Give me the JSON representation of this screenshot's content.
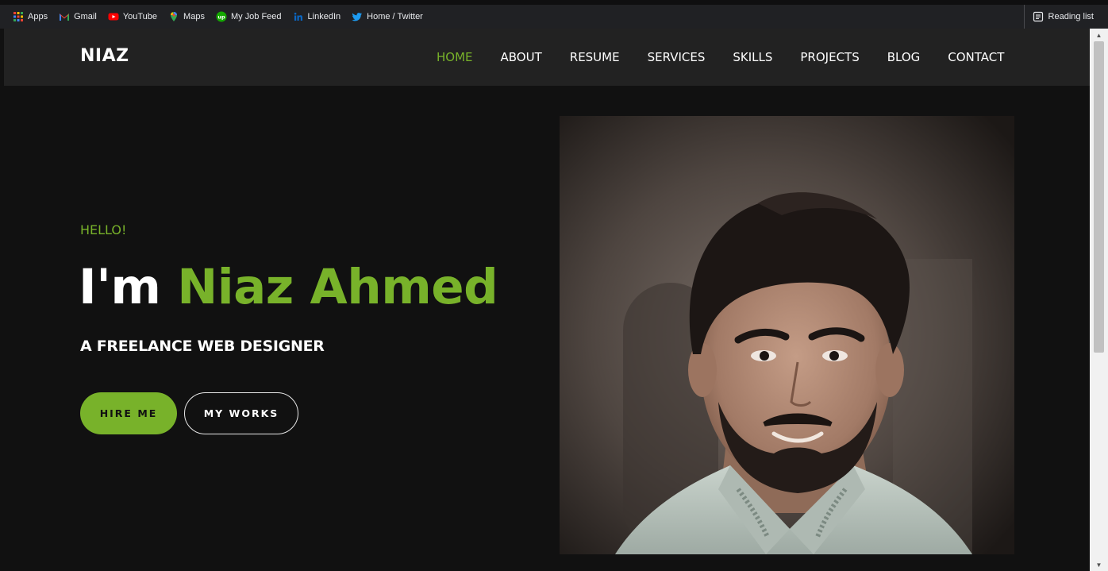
{
  "browser": {
    "bookmarks": [
      {
        "label": "Apps",
        "icon": "apps-grid-icon"
      },
      {
        "label": "Gmail",
        "icon": "gmail-icon"
      },
      {
        "label": "YouTube",
        "icon": "youtube-icon"
      },
      {
        "label": "Maps",
        "icon": "maps-icon"
      },
      {
        "label": "My Job Feed",
        "icon": "upwork-icon"
      },
      {
        "label": "LinkedIn",
        "icon": "linkedin-icon"
      },
      {
        "label": "Home / Twitter",
        "icon": "twitter-icon"
      }
    ],
    "reading_list": "Reading list"
  },
  "site": {
    "logo": "NIAZ",
    "nav": [
      {
        "label": "HOME",
        "active": true
      },
      {
        "label": "ABOUT",
        "active": false
      },
      {
        "label": "RESUME",
        "active": false
      },
      {
        "label": "SERVICES",
        "active": false
      },
      {
        "label": "SKILLS",
        "active": false
      },
      {
        "label": "PROJECTS",
        "active": false
      },
      {
        "label": "BLOG",
        "active": false
      },
      {
        "label": "CONTACT",
        "active": false
      }
    ]
  },
  "hero": {
    "greeting": "HELLO!",
    "headline_prefix": "I'm",
    "headline_name": "Niaz Ahmed",
    "subtitle": "A FREELANCE WEB DESIGNER",
    "primary_button": "HIRE ME",
    "secondary_button": "MY WORKS",
    "photo": "portrait-photo"
  },
  "colors": {
    "accent": "#78b22a",
    "background": "#111111",
    "navbar": "#222222"
  }
}
